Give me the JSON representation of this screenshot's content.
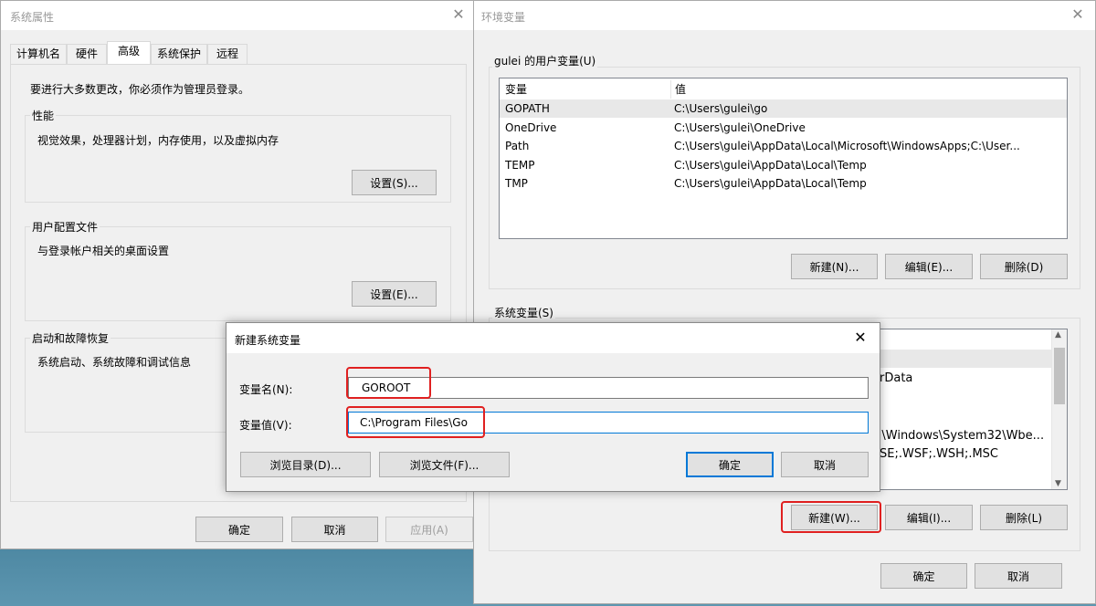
{
  "sys_props": {
    "title": "系统属性",
    "tabs": [
      "计算机名",
      "硬件",
      "高级",
      "系统保护",
      "远程"
    ],
    "admin_note": "要进行大多数更改，你必须作为管理员登录。",
    "performance": {
      "label": "性能",
      "desc": "视觉效果，处理器计划，内存使用，以及虚拟内存",
      "button": "设置(S)..."
    },
    "profiles": {
      "label": "用户配置文件",
      "desc": "与登录帐户相关的桌面设置",
      "button": "设置(E)..."
    },
    "startup": {
      "label": "启动和故障恢复",
      "desc": "系统启动、系统故障和调试信息"
    },
    "footer": {
      "ok": "确定",
      "cancel": "取消",
      "apply": "应用(A)"
    }
  },
  "env_vars": {
    "title": "环境变量",
    "user_group_label": "gulei 的用户变量(U)",
    "columns": {
      "name": "变量",
      "value": "值"
    },
    "user_vars": [
      {
        "name": "GOPATH",
        "value": "C:\\Users\\gulei\\go"
      },
      {
        "name": "OneDrive",
        "value": "C:\\Users\\gulei\\OneDrive"
      },
      {
        "name": "Path",
        "value": "C:\\Users\\gulei\\AppData\\Local\\Microsoft\\WindowsApps;C:\\User..."
      },
      {
        "name": "TEMP",
        "value": "C:\\Users\\gulei\\AppData\\Local\\Temp"
      },
      {
        "name": "TMP",
        "value": "C:\\Users\\gulei\\AppData\\Local\\Temp"
      }
    ],
    "user_buttons": {
      "new": "新建(N)...",
      "edit": "编辑(E)...",
      "delete": "删除(D)"
    },
    "system_group_label": "系统变量(S)",
    "system_visible_fragments": [
      "rData",
      ":\\Windows\\System32\\Wbe...",
      "SE;.WSF;.WSH;.MSC"
    ],
    "system_buttons": {
      "new": "新建(W)...",
      "edit": "编辑(I)...",
      "delete": "删除(L)"
    },
    "footer": {
      "ok": "确定",
      "cancel": "取消"
    }
  },
  "new_var_dialog": {
    "title": "新建系统变量",
    "name_label": "变量名(N):",
    "name_value": "GOROOT",
    "value_label": "变量值(V):",
    "value_value": "C:\\Program Files\\Go",
    "browse_dir": "浏览目录(D)...",
    "browse_file": "浏览文件(F)...",
    "ok": "确定",
    "cancel": "取消"
  },
  "icons": {
    "close": "close-icon",
    "scroll_up": "chevron-up-icon",
    "scroll_down": "chevron-down-icon"
  },
  "colors": {
    "focus_border": "#0078d7",
    "highlight": "#e02020",
    "selected_row": "#e8e8e8"
  }
}
